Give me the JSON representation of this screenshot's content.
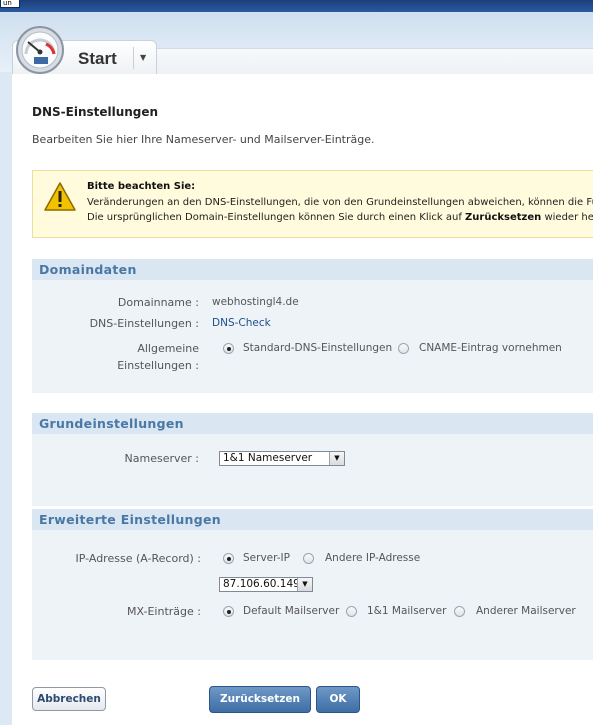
{
  "topbar": {
    "tab_label": "un"
  },
  "start_tab": {
    "label": "Start",
    "menu_icon": "triangle-down"
  },
  "page": {
    "title": "DNS-Einstellungen",
    "subtitle": "Bearbeiten Sie hier Ihre Nameserver- und Mailserver-Einträge."
  },
  "notice": {
    "title": "Bitte beachten Sie:",
    "line1": "Veränderungen an den DNS-Einstellungen, die von den Grundeinstellungen abweichen, können die Fun",
    "line2_prefix": "Die ursprünglichen Domain-Einstellungen können Sie durch einen Klick auf ",
    "line2_bold": "Zurücksetzen",
    "line2_suffix": " wieder herste"
  },
  "domaindaten": {
    "title": "Domaindaten",
    "domainname_label": "Domainname :",
    "domainname_value": "webhostingl4.de",
    "dns_label": "DNS-Einstellungen :",
    "dns_link": "DNS-Check",
    "allgemeine_label_1": "Allgemeine",
    "allgemeine_label_2": "Einstellungen :",
    "option_standard": "Standard-DNS-Einstellungen",
    "option_cname": "CNAME-Eintrag vornehmen",
    "selected": "standard"
  },
  "grundeinstellungen": {
    "title": "Grundeinstellungen",
    "nameserver_label": "Nameserver :",
    "nameserver_value": "1&1 Nameserver"
  },
  "erweitert": {
    "title": "Erweiterte Einstellungen",
    "ip_label": "IP-Adresse (A-Record) :",
    "option_server_ip": "Server-IP",
    "option_andere_ip": "Andere IP-Adresse",
    "ip_selected": "server-ip",
    "ip_value": "87.106.60.149",
    "mx_label": "MX-Einträge :",
    "option_default_mail": "Default Mailserver",
    "option_11_mail": "1&1 Mailserver",
    "option_andere_mail": "Anderer Mailserver",
    "mx_selected": "default"
  },
  "buttons": {
    "cancel": "Abbrechen",
    "reset": "Zurücksetzen",
    "ok": "OK"
  },
  "colors": {
    "section_title": "#4a78a6",
    "primary_button": "#3d6ea5",
    "notice_bg": "#fffbdc"
  }
}
